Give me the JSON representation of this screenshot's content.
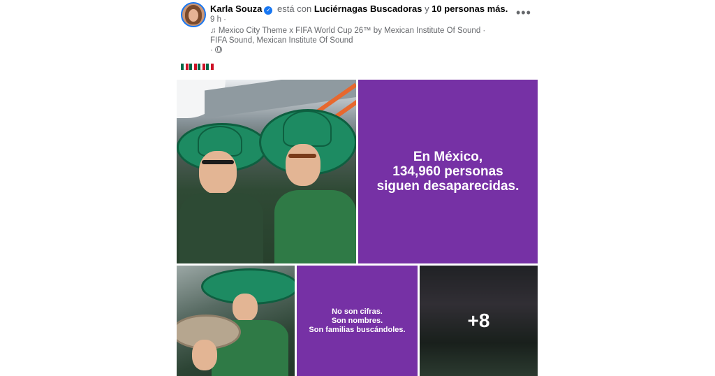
{
  "post": {
    "author": "Karla Souza",
    "with_text": "está con",
    "tagged": "Luciérnagas Buscadoras",
    "and_text": "y",
    "others": "10 personas más.",
    "time": "9 h ·",
    "music_line1": "Mexico City Theme x FIFA World Cup 26™   by Mexican Institute Of Sound ·",
    "music_line2": "FIFA Sound, Mexican Institute Of Sound",
    "privacy_dot": "·",
    "more": "•••",
    "caption_flags": 4
  },
  "media": {
    "headline": "En México, 134,960 personas siguen desaparecidas.",
    "headline_lines": [
      "En México,",
      "134,960 personas",
      "siguen desaparecidas."
    ],
    "message_lines": [
      "No son cifras.",
      "Son nombres.",
      "Son familias buscándoles."
    ],
    "more_count": "+8"
  },
  "icons": {
    "verified": "verified-badge-icon",
    "music": "music-note-icon",
    "privacy": "globe-icon",
    "more": "more-options-icon"
  },
  "colors": {
    "purple": "#7631a5",
    "link_blue": "#1877f2",
    "muted": "#65676b"
  }
}
